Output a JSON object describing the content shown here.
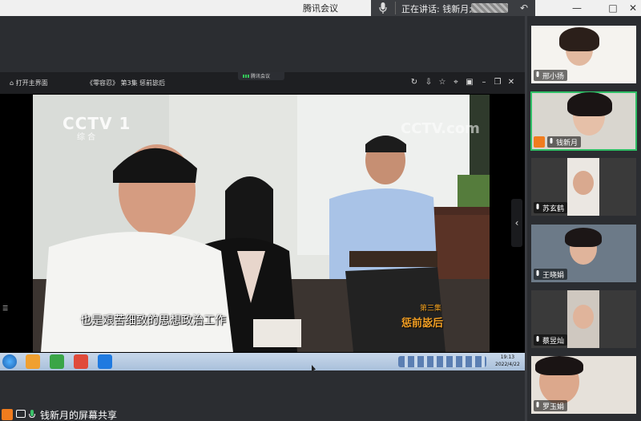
{
  "app": {
    "title": "腾讯会议",
    "speaking_label": "正在讲话: 钱新月;",
    "window_buttons": [
      "—",
      "□",
      "✕"
    ]
  },
  "browser": {
    "home_label": "打开主界面",
    "page_title": "《零容忍》 第3集 惩前毖后",
    "meeting_chip": "腾讯会议",
    "icons": [
      "refresh-icon",
      "download-icon",
      "star-icon",
      "pin-icon",
      "screenshot-icon",
      "minimize-icon",
      "restore-icon",
      "close-icon"
    ]
  },
  "video": {
    "channel_logo": "CCTV 1",
    "channel_sub": "综 合",
    "watermark": "CCTV.com",
    "subtitle": "也是艰苦细致的思想政治工作",
    "episode_label": "第三集",
    "episode_title": "惩前毖后"
  },
  "taskbar": {
    "time": "19:13",
    "date": "2022/4/22"
  },
  "share_status": {
    "label": "钱新月的屏幕共享"
  },
  "participants": [
    {
      "name": "邢小扬",
      "active": false,
      "host": false
    },
    {
      "name": "钱新月",
      "active": true,
      "host": true
    },
    {
      "name": "苏玄鹤",
      "active": false,
      "host": false
    },
    {
      "name": "王晓娟",
      "active": false,
      "host": false
    },
    {
      "name": "蔡昱灿",
      "active": false,
      "host": false
    },
    {
      "name": "罗玉娟",
      "active": false,
      "host": false
    }
  ],
  "colors": {
    "accent_green": "#2fbf66",
    "host_orange": "#f07c1e",
    "episode_gold": "#f4a024"
  }
}
